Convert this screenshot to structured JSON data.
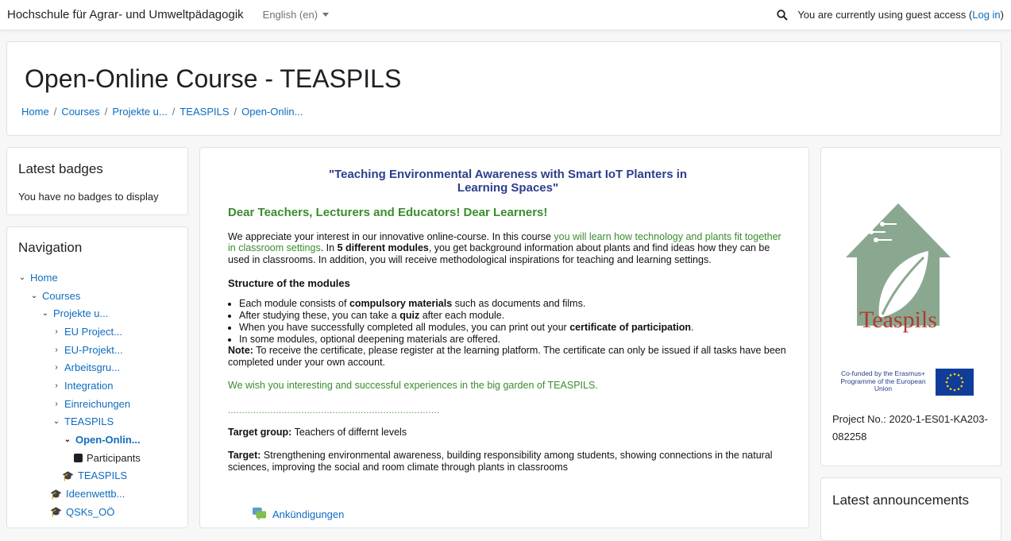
{
  "topbar": {
    "site_name": "Hochschule für Agrar- und Umweltpädagogik",
    "language": "English (en)",
    "access_text": "You are currently using guest access (",
    "login_link": "Log in",
    "access_close": ")"
  },
  "header": {
    "title": "Open-Online Course - TEASPILS",
    "breadcrumb": [
      "Home",
      "Courses",
      "Projekte u...",
      "TEASPILS",
      "Open-Onlin..."
    ],
    "breadcrumb_sep": "/"
  },
  "badges_block": {
    "title": "Latest badges",
    "text": "You have no badges to display"
  },
  "navigation": {
    "title": "Navigation",
    "items": [
      {
        "label": "Home",
        "chev": "⌄"
      },
      {
        "label": "Courses",
        "chev": "⌄"
      },
      {
        "label": "Projekte u...",
        "chev": "⌄"
      },
      {
        "label": "EU Project...",
        "chev": "›"
      },
      {
        "label": "EU-Projekt...",
        "chev": "›"
      },
      {
        "label": "Arbeitsgru...",
        "chev": "›"
      },
      {
        "label": "Integration",
        "chev": "›"
      },
      {
        "label": "Einreichungen",
        "chev": "›"
      },
      {
        "label": "TEASPILS",
        "chev": "⌄"
      },
      {
        "label": "Open-Onlin...",
        "chev": "⌄"
      },
      {
        "label": "Participants"
      },
      {
        "label": "TEASPILS"
      },
      {
        "label": "Ideenwettb..."
      },
      {
        "label": "QSKs_OÖ"
      }
    ]
  },
  "main": {
    "lead_line1": "\"Teaching Environmental Awareness with Smart IoT Planters in",
    "lead_line2": "Learning Spaces\"",
    "greeting": "Dear Teachers, Lecturers and Educators! Dear Learners!",
    "intro_a": "We appreciate your interest in our innovative online-course. In this course ",
    "intro_green": "you will learn how technology and plants fit together in classroom settings",
    "intro_b": ". In ",
    "intro_bold": "5 different modules",
    "intro_c": ", you get background information about plants and find ideas how they can be used in classrooms. In addition, you will receive methodological inspirations for teaching and learning settings.",
    "structure_title": "Structure of the modules",
    "m1_a": "Each module consists of ",
    "m1_bold": "compulsory materials",
    "m1_b": " such as documents and films.",
    "m2_a": "After studying these, you can take a ",
    "m2_bold": "quiz",
    "m2_b": " after each module.",
    "m3_a": "When you have successfully completed all modules, you can print out your ",
    "m3_bold": "certificate of participation",
    "m3_b": ".",
    "m4": "In some modules, optional deepening materials are offered.",
    "note_label": "Note:",
    "note_text": " To receive the certificate, please register at the learning platform. The certificate can only be issued if all tasks have been completed under your own account.",
    "wish": "We wish you interesting and successful experiences in the big garden of TEASPILS.",
    "dots": "...........................................................................",
    "target_group_label": "Target group:",
    "target_group_text": " Teachers of differnt levels",
    "target_label": "Target:",
    "target_text": " Strengthening environmental awareness, building responsibility among students, showing connections in the natural sciences, improving the social and room climate through plants in classrooms",
    "announcements_link": "Ankündigungen"
  },
  "right_block": {
    "logo_text": "Teaspils",
    "eu_text": "Co-funded by the Erasmus+ Programme of the European Union",
    "project_no": "Project No.: 2020-1-ES01-KA203-082258"
  },
  "announcements_block": {
    "title": "Latest announcements"
  },
  "colors": {
    "link": "#0f6cbf",
    "lead_blue": "#2d3e8c",
    "green": "#3a8c2e",
    "logo_green": "#8aa890",
    "logo_red": "#b03a2e",
    "eu_blue": "#103d9a"
  }
}
